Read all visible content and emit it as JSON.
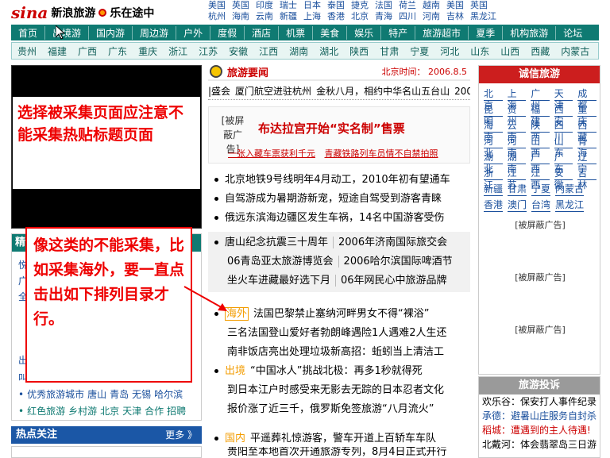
{
  "header": {
    "logo_brand": "sina",
    "logo_text": "新浪旅游",
    "logo_slogan": "乐在途中",
    "cities_row1": [
      "美国",
      "英国",
      "印度",
      "瑞士",
      "日本",
      "泰国",
      "捷克",
      "法国",
      "荷兰",
      "越南",
      "美国",
      "英国"
    ],
    "cities_row2": [
      "杭州",
      "海南",
      "云南",
      "新疆",
      "上海",
      "香港",
      "北京",
      "青海",
      "四川",
      "河南",
      "吉林",
      "黑龙江"
    ]
  },
  "nav_main": [
    "首页",
    "出境游",
    "国内游",
    "周边游",
    "户外",
    "度假",
    "酒店",
    "机票",
    "美食",
    "娱乐",
    "特产",
    "旅游超市",
    "夏季",
    "机构旅游",
    "论坛"
  ],
  "nav_provinces": [
    "贵州",
    "福建",
    "广西",
    "广东",
    "重庆",
    "浙江",
    "江苏",
    "安徽",
    "江西",
    "湖南",
    "湖北",
    "陕西",
    "甘肃",
    "宁夏",
    "河北",
    "山东",
    "山西",
    "西藏",
    "内蒙古"
  ],
  "left": {
    "overlay_text": "选择被采集页面应注意不能采集热贴标题页面",
    "box_title": "精",
    "box_stubs": [
      "悦",
      "广",
      "全",
      "出"
    ],
    "links_row1": [
      "叫",
      "即埔",
      "日",
      "加龙百",
      "钩鱼"
    ],
    "links_row2": [
      "优秀旅游城市",
      "唐山",
      "青岛",
      "无锡",
      "哈尔滨"
    ],
    "links_row3": [
      "红色旅游",
      "乡村游",
      "北京",
      "天津",
      "合作",
      "招聘"
    ],
    "hot_title": "热点关注",
    "hot_more": "更多 》"
  },
  "middle": {
    "section_title": "旅游要闻",
    "section_time": "北京时间： 2006.8.5",
    "ticker": [
      "|盛会",
      "厦门航空进驻杭州",
      "金秋八月，相约中华名山五台山",
      "2006"
    ],
    "ad_tag": "[被屏蔽广告]",
    "ad_headline": "布达拉宫开始“实名制”售票",
    "ad_sub1": "一张入藏车票获利千元",
    "ad_sub2": "青藏铁路列车员情不自禁拍照",
    "news1": [
      "北京地铁9号线明年4月动工，2010年初有望通车",
      "自驾游成为暑期游新宠，短途自驾受到游客青睐",
      "俄远东滨海边疆区发生车祸，14名中国游客受伤"
    ],
    "grey_rows": [
      [
        "唐山纪念抗震三十周年",
        "2006年济南国际旅交会"
      ],
      [
        "06青岛亚太旅游博览会",
        "2006哈尔滨国际啤酒节"
      ],
      [
        "坐火车进藏最好选下月",
        "06年网民心中旅游品牌"
      ]
    ],
    "abroad_tag": "海外",
    "abroad_news": [
      "法国巴黎禁止塞纳河畔男女不得“裸浴”",
      "三名法国登山爱好者勃朗峰遇险1人遇难2人生还",
      "南非饭店亮出处理垃圾新高招：蚯蚓当上清洁工"
    ],
    "jing_tag": "出境",
    "jing_news": [
      "“中国冰人”挑战北极：再多1秒就得死",
      "到日本江户时感受来无影去无踪的日本忍者文化",
      "报价涨了近三千，俄罗斯免签旅游“八月流火”"
    ],
    "guonei_tag": "国内",
    "guonei_news": [
      "平遥葬礼惊游客，警车开道上百轿车车队",
      "贵阳至本地首次开通旅游专列，8月4日正式开行"
    ]
  },
  "right": {
    "title": "诚信旅游",
    "city_rows": [
      [
        "北京",
        "上海",
        "广州",
        "天津",
        "成都"
      ],
      [
        "昆明",
        "贵州",
        "福建",
        "西安",
        "重庆"
      ],
      [
        "海南",
        "云南",
        "陕西",
        "四川",
        "西藏"
      ],
      [
        "河北",
        "河南",
        "山西",
        "山东",
        "青海"
      ],
      [
        "湖北",
        "湖南",
        "广西",
        "广东",
        "辽宁"
      ],
      [
        "浙江",
        "江苏",
        "江西",
        "安徽",
        "吉林"
      ],
      [
        "新疆",
        "甘肃",
        "宁夏",
        "内蒙古"
      ],
      [
        "香港",
        "澳门",
        "台湾",
        "黑龙江"
      ]
    ],
    "ad_tag": "[被屏蔽广告]",
    "complaint_title": "旅游投诉",
    "complaints": [
      "欢乐谷：保安打人事件纪录",
      "承德：避暑山庄服务自封杀",
      "稻城：遭遇到的主人待遇!",
      "北戴河：体会翡翠岛三日游"
    ]
  },
  "annotation": {
    "text": "像这类的不能采集，比如采集海外，要一直点击出如下排列目录才行。"
  },
  "colors": {
    "nav_teal": "#0f7a72",
    "accent_red": "#cc1e1e",
    "link_blue": "#1a4f9c",
    "annotation_red": "#ee0000"
  }
}
